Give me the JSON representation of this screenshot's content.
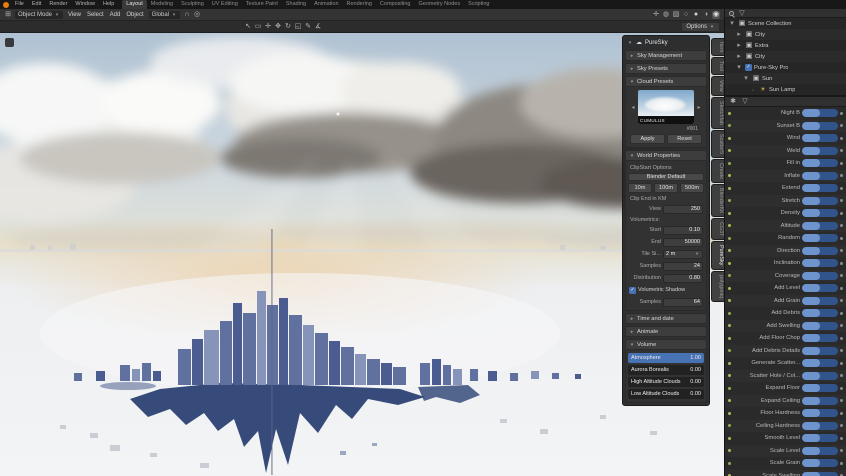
{
  "colors": {
    "accent": "#4772b3",
    "slider-fill": "#6d94cc",
    "slider-track": "#31548a",
    "dot-yellow": "#b5b85a"
  },
  "topbar": {
    "menus": [
      "File",
      "Edit",
      "Render",
      "Window",
      "Help"
    ],
    "workspaces": [
      {
        "label": "Layout",
        "active": true
      },
      {
        "label": "Modeling",
        "active": false
      },
      {
        "label": "Sculpting",
        "active": false
      },
      {
        "label": "UV Editing",
        "active": false
      },
      {
        "label": "Texture Paint",
        "active": false
      },
      {
        "label": "Shading",
        "active": false
      },
      {
        "label": "Animation",
        "active": false
      },
      {
        "label": "Rendering",
        "active": false
      },
      {
        "label": "Compositing",
        "active": false
      },
      {
        "label": "Geometry Nodes",
        "active": false
      },
      {
        "label": "Scripting",
        "active": false
      }
    ]
  },
  "viewport_header": {
    "mode": "Object Mode",
    "menus": [
      "View",
      "Select",
      "Add",
      "Object"
    ],
    "orientation": "Global",
    "options_label": "Options"
  },
  "toolbar_icons": {
    "header_left": [
      "editor-type"
    ],
    "header_mid": [
      "snap-magnet",
      "proportional-edit"
    ],
    "header_right": [
      "gizmo",
      "overlays",
      "xray",
      "shading-wireframe",
      "shading-solid",
      "shading-material",
      "shading-rendered"
    ],
    "tools_left": [
      "tweak",
      "select-box",
      "cursor",
      "move",
      "rotate",
      "scale",
      "annotate",
      "measure"
    ]
  },
  "ntabs": [
    {
      "label": "Item",
      "active": false
    },
    {
      "label": "Tool",
      "active": false
    },
    {
      "label": "View",
      "active": false
    },
    {
      "label": "Sketchfab",
      "active": false
    },
    {
      "label": "Scatter5",
      "active": false
    },
    {
      "label": "Create",
      "active": false
    },
    {
      "label": "BlenderKit",
      "active": false
    },
    {
      "label": "CG3T",
      "active": false
    },
    {
      "label": "PureSky",
      "active": true
    },
    {
      "label": "polygoniq",
      "active": false
    }
  ],
  "npanel": {
    "title": "PureSky",
    "sections": {
      "sky_management": "Sky Management",
      "sky_presets": "Sky Presets",
      "cloud_presets": "Cloud Presets",
      "world_properties": "World Properties",
      "time_and_date": "Time and date",
      "animate": "Animate",
      "volume": "Volume"
    },
    "cloud_preset": {
      "name": "CUMULUS",
      "number": "#001",
      "apply": "Apply",
      "reset": "Reset"
    },
    "world": {
      "clipstart_label": "ClipStart Options",
      "blender_default": "Blender Default",
      "clip_buttons": [
        "10m",
        "100m",
        "500m"
      ],
      "clip_end_label": "Clip End in KM",
      "view_label": "View",
      "view_value": "250",
      "volumetrics_label": "Volumetrics:",
      "start_label": "Start",
      "start_value": "0.10",
      "end_label": "End",
      "end_value": "50000",
      "tile_label": "Tile Si...",
      "tile_value": "2 m",
      "samples_label": "Samples",
      "samples_value": "24",
      "distribution_label": "Distribution",
      "distribution_value": "0.80",
      "shadow_label": "Volumetric Shadow",
      "shadow_samples_label": "Samples",
      "shadow_samples_value": "64"
    },
    "volume_sliders": [
      {
        "label": "Atmosphere",
        "value": "1.00",
        "fill": 1
      },
      {
        "label": "Aurora Borealis",
        "value": "0.00",
        "fill": 0
      },
      {
        "label": "High Altitude Clouds",
        "value": "0.00",
        "fill": 0
      },
      {
        "label": "Low Altitude Clouds",
        "value": "0.00",
        "fill": 0
      }
    ]
  },
  "outliner": {
    "rows": [
      {
        "label": "Scene Collection",
        "icon": "collection",
        "arrow": "down",
        "indent": 0
      },
      {
        "label": "City",
        "icon": "collection",
        "arrow": "right",
        "indent": 1
      },
      {
        "label": "Extra",
        "icon": "collection",
        "arrow": "right",
        "indent": 1
      },
      {
        "label": "City",
        "icon": "collection",
        "arrow": "right",
        "indent": 1
      },
      {
        "label": "Pure-Sky Pro",
        "icon": "check",
        "arrow": "down",
        "indent": 1
      },
      {
        "label": "Sun",
        "icon": "collection",
        "arrow": "down",
        "indent": 2
      },
      {
        "label": "Sun Lamp",
        "icon": "sun",
        "arrow": "none",
        "indent": 3
      }
    ]
  },
  "properties": {
    "rows": [
      {
        "label": "Night B",
        "fill": 0.5
      },
      {
        "label": "Sunset B",
        "fill": 0.5
      },
      {
        "label": "Wind",
        "fill": 0.5
      },
      {
        "label": "Weld",
        "fill": 0.5
      },
      {
        "label": "Fill in",
        "fill": 0.5
      },
      {
        "label": "Inflate",
        "fill": 0.5
      },
      {
        "label": "Extend",
        "fill": 0.5
      },
      {
        "label": "Stretch",
        "fill": 0.5
      },
      {
        "label": "Density",
        "fill": 0.5
      },
      {
        "label": "Altitude",
        "fill": 0.5
      },
      {
        "label": "Random",
        "fill": 0.5
      },
      {
        "label": "Direction",
        "fill": 0.5
      },
      {
        "label": "Inclination",
        "fill": 0.5
      },
      {
        "label": "Coverage",
        "fill": 0.5
      },
      {
        "label": "Add Level",
        "fill": 0.5
      },
      {
        "label": "Add Grain",
        "fill": 0.5
      },
      {
        "label": "Add Debris",
        "fill": 0.5
      },
      {
        "label": "Add Swelling",
        "fill": 0.5
      },
      {
        "label": "Add Floor Chop",
        "fill": 0.5
      },
      {
        "label": "Add Debris Details",
        "fill": 0.5
      },
      {
        "label": "Generate Scatter...",
        "fill": 0.5
      },
      {
        "label": "Scatter Hole / Col...",
        "fill": 0.5
      },
      {
        "label": "Expand Floor",
        "fill": 0.5
      },
      {
        "label": "Expand Ceiling",
        "fill": 0.5
      },
      {
        "label": "Floor Hardness",
        "fill": 0.5
      },
      {
        "label": "Ceiling Hardness",
        "fill": 0.5
      },
      {
        "label": "Smooth Level",
        "fill": 0.5
      },
      {
        "label": "Scale Level",
        "fill": 0.5
      },
      {
        "label": "Scale Grain",
        "fill": 0.5
      },
      {
        "label": "Scale Swelling",
        "fill": 0.5
      }
    ]
  }
}
